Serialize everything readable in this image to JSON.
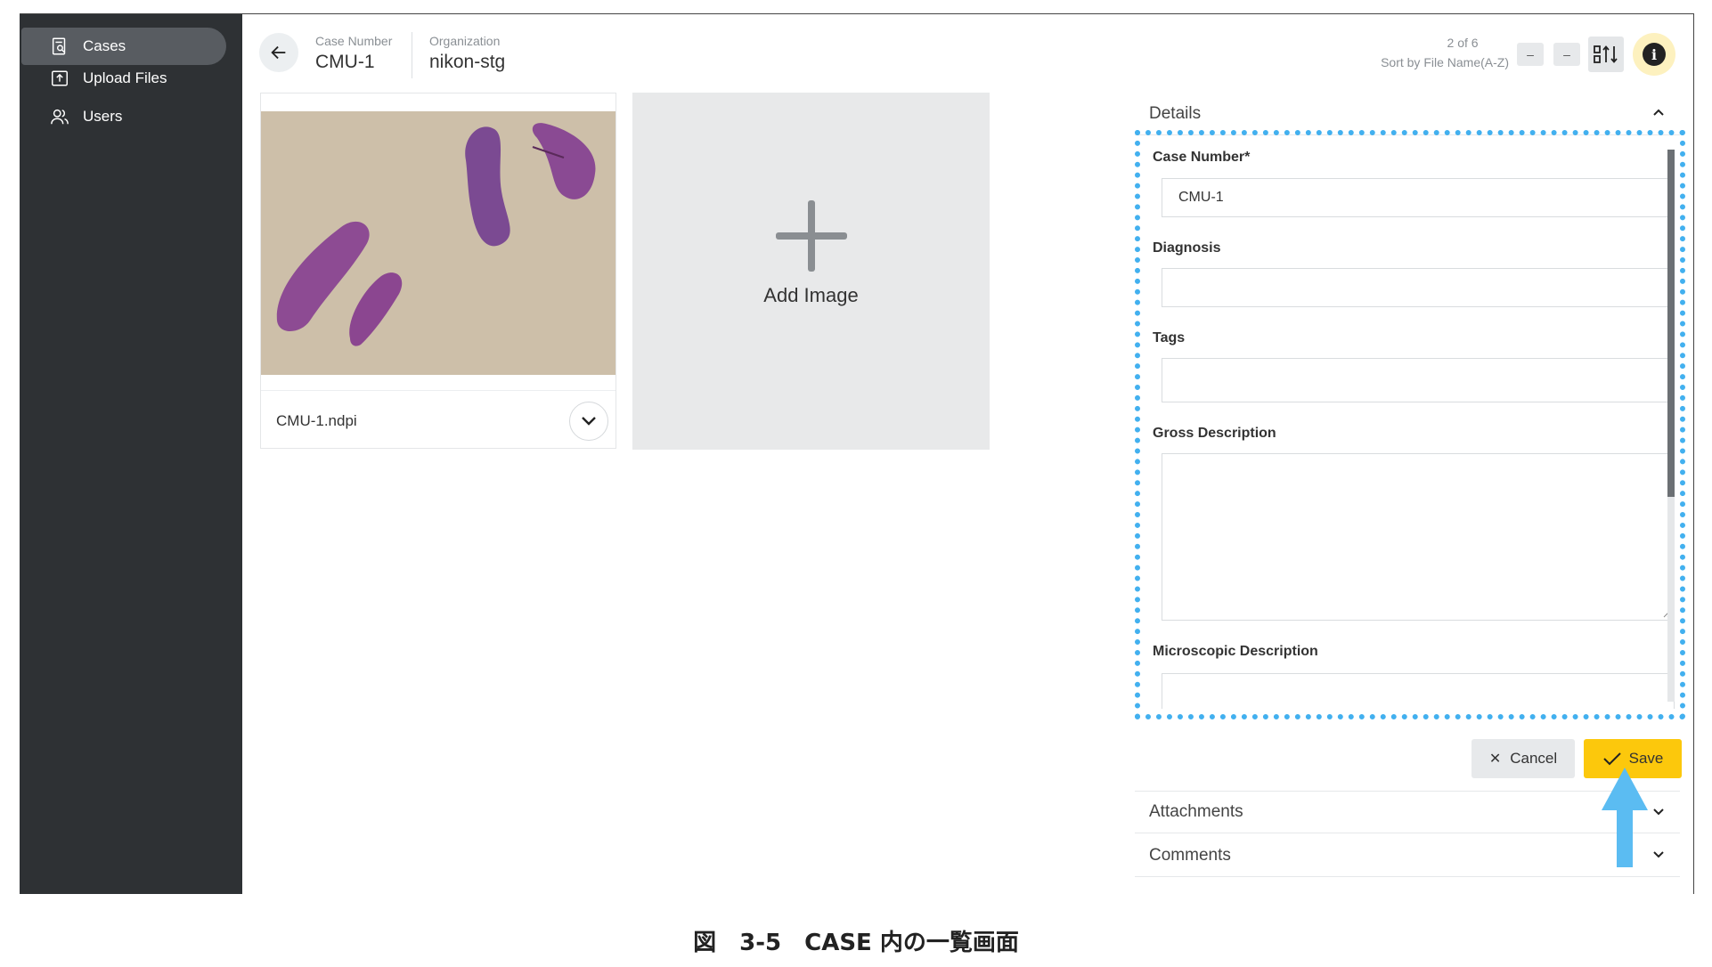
{
  "sidebar": {
    "items": [
      {
        "label": "Cases",
        "icon": "search-document-icon",
        "active": true
      },
      {
        "label": "Upload Files",
        "icon": "upload-folder-icon",
        "active": false
      },
      {
        "label": "Users",
        "icon": "users-icon",
        "active": false
      }
    ]
  },
  "header": {
    "case_number_label": "Case Number",
    "case_number_value": "CMU-1",
    "organization_label": "Organization",
    "organization_value": "nikon-stg",
    "pager_count": "2 of 6",
    "sort_label": "Sort by File Name(A-Z)",
    "minus_1": "–",
    "minus_2": "–"
  },
  "images": [
    {
      "filename": "CMU-1.ndpi"
    }
  ],
  "add_image_label": "Add Image",
  "details": {
    "title": "Details",
    "fields": {
      "case_number_label": "Case Number*",
      "case_number_value": "CMU-1",
      "diagnosis_label": "Diagnosis",
      "tags_label": "Tags",
      "gross_label": "Gross Description",
      "microscopic_label": "Microscopic Description"
    },
    "cancel_label": "Cancel",
    "save_label": "Save"
  },
  "attachments_label": "Attachments",
  "comments_label": "Comments",
  "colors": {
    "sidebar_bg": "#2e3134",
    "save_button": "#fcc80c",
    "highlight_dotted": "#42b0ef",
    "arrow": "#5bbcf2"
  },
  "caption": "図　3-5　CASE 内の一覧画面"
}
